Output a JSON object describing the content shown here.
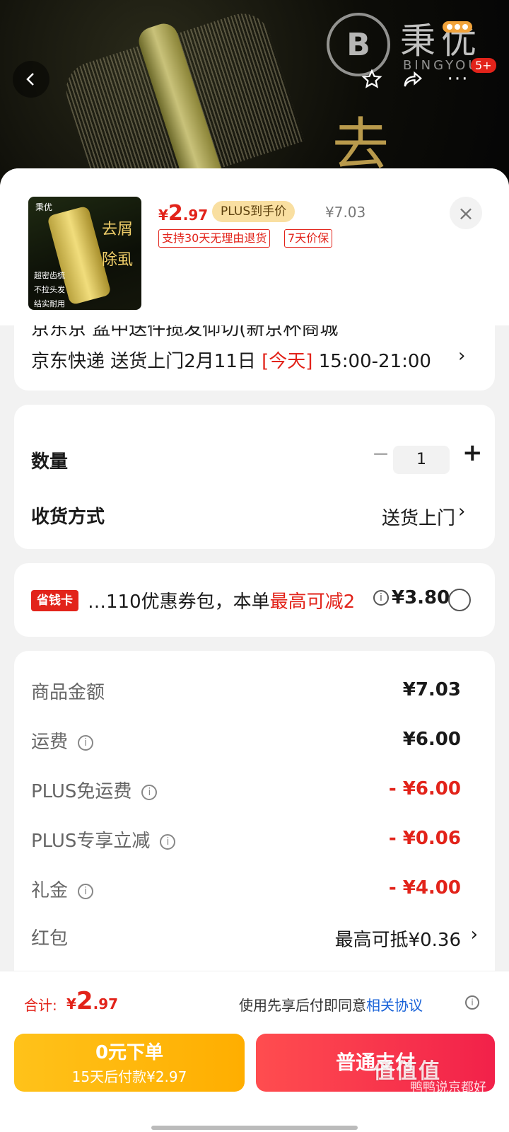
{
  "hero": {
    "brand_cn": "秉优",
    "brand_en": "BINGYOU",
    "brand_mark": "B",
    "hero_char": "去",
    "badge_count": "5+",
    "icons": {
      "back": "chevron-left-icon",
      "favorite": "star-icon",
      "share": "share-icon",
      "more": "more-dots-icon"
    }
  },
  "product": {
    "thumb": {
      "logo": "秉优",
      "char1": "去屑",
      "char2": "除虱",
      "lines": [
        "超密齿梳",
        "不拉头发",
        "结实耐用"
      ]
    },
    "price_currency": "¥",
    "price_int": "2",
    "price_dec": ".97",
    "plus_tag": "PLUS到手价",
    "orig_price": "¥7.03",
    "tags": [
      "支持30天无理由退货",
      "7天价保"
    ]
  },
  "delivery": {
    "cut_line": "京东京 盆中送件揽发仰切(新京杯商城",
    "carrier": "京东快递 送货上门2月11日 ",
    "today": "[今天]",
    "time_window": " 15:00-21:00"
  },
  "quantity": {
    "label": "数量",
    "value": "1",
    "minus": "−",
    "plus": "+"
  },
  "receive": {
    "label": "收货方式",
    "value": "送货上门"
  },
  "coupon": {
    "badge": "省钱卡",
    "text": "…110优惠券包，本单",
    "highlight": "最高可减2",
    "amount": "¥3.80"
  },
  "summary": {
    "rows": [
      {
        "label": "商品金额",
        "value": "¥7.03",
        "red": false,
        "info": false
      },
      {
        "label": "运费",
        "value": "¥6.00",
        "red": false,
        "info": true
      },
      {
        "label": "PLUS免运费",
        "value": "- ¥6.00",
        "red": true,
        "info": true
      },
      {
        "label": "PLUS专享立减",
        "value": "- ¥0.06",
        "red": true,
        "info": true
      },
      {
        "label": "礼金",
        "value": "- ¥4.00",
        "red": true,
        "info": true
      }
    ],
    "redpacket_label": "红包",
    "redpacket_value": "最高可抵¥0.36"
  },
  "footer": {
    "total_label": "合计:",
    "total_currency": "¥",
    "total_int": "2",
    "total_dec": ".97",
    "agree_prefix": "使用先享后付即同意",
    "agree_link": "相关协议",
    "later_title": "0元下单",
    "later_sub": "15天后付款¥2.97",
    "pay_label": "普通支付",
    "watermark": "值值值",
    "watermark_sub": "鸭鸭说京都好"
  },
  "colors": {
    "accent_red": "#e2231a",
    "plus_gold": "#f9dfa1",
    "later_yellow": "#ffb400",
    "link_blue": "#1a63d8"
  }
}
